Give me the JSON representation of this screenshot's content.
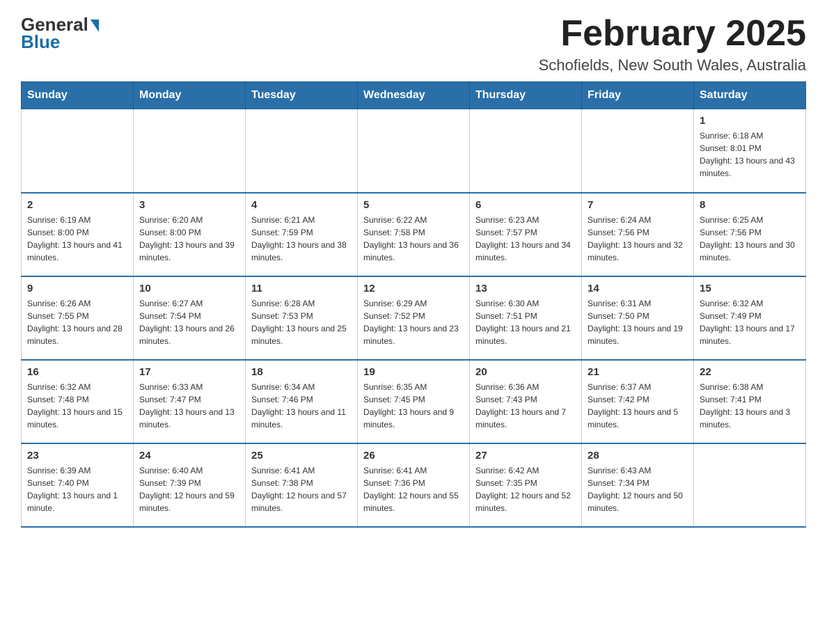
{
  "header": {
    "logo_general": "General",
    "logo_blue": "Blue",
    "title": "February 2025",
    "subtitle": "Schofields, New South Wales, Australia"
  },
  "days_of_week": [
    "Sunday",
    "Monday",
    "Tuesday",
    "Wednesday",
    "Thursday",
    "Friday",
    "Saturday"
  ],
  "weeks": [
    {
      "days": [
        {
          "number": "",
          "info": ""
        },
        {
          "number": "",
          "info": ""
        },
        {
          "number": "",
          "info": ""
        },
        {
          "number": "",
          "info": ""
        },
        {
          "number": "",
          "info": ""
        },
        {
          "number": "",
          "info": ""
        },
        {
          "number": "1",
          "info": "Sunrise: 6:18 AM\nSunset: 8:01 PM\nDaylight: 13 hours and 43 minutes."
        }
      ]
    },
    {
      "days": [
        {
          "number": "2",
          "info": "Sunrise: 6:19 AM\nSunset: 8:00 PM\nDaylight: 13 hours and 41 minutes."
        },
        {
          "number": "3",
          "info": "Sunrise: 6:20 AM\nSunset: 8:00 PM\nDaylight: 13 hours and 39 minutes."
        },
        {
          "number": "4",
          "info": "Sunrise: 6:21 AM\nSunset: 7:59 PM\nDaylight: 13 hours and 38 minutes."
        },
        {
          "number": "5",
          "info": "Sunrise: 6:22 AM\nSunset: 7:58 PM\nDaylight: 13 hours and 36 minutes."
        },
        {
          "number": "6",
          "info": "Sunrise: 6:23 AM\nSunset: 7:57 PM\nDaylight: 13 hours and 34 minutes."
        },
        {
          "number": "7",
          "info": "Sunrise: 6:24 AM\nSunset: 7:56 PM\nDaylight: 13 hours and 32 minutes."
        },
        {
          "number": "8",
          "info": "Sunrise: 6:25 AM\nSunset: 7:56 PM\nDaylight: 13 hours and 30 minutes."
        }
      ]
    },
    {
      "days": [
        {
          "number": "9",
          "info": "Sunrise: 6:26 AM\nSunset: 7:55 PM\nDaylight: 13 hours and 28 minutes."
        },
        {
          "number": "10",
          "info": "Sunrise: 6:27 AM\nSunset: 7:54 PM\nDaylight: 13 hours and 26 minutes."
        },
        {
          "number": "11",
          "info": "Sunrise: 6:28 AM\nSunset: 7:53 PM\nDaylight: 13 hours and 25 minutes."
        },
        {
          "number": "12",
          "info": "Sunrise: 6:29 AM\nSunset: 7:52 PM\nDaylight: 13 hours and 23 minutes."
        },
        {
          "number": "13",
          "info": "Sunrise: 6:30 AM\nSunset: 7:51 PM\nDaylight: 13 hours and 21 minutes."
        },
        {
          "number": "14",
          "info": "Sunrise: 6:31 AM\nSunset: 7:50 PM\nDaylight: 13 hours and 19 minutes."
        },
        {
          "number": "15",
          "info": "Sunrise: 6:32 AM\nSunset: 7:49 PM\nDaylight: 13 hours and 17 minutes."
        }
      ]
    },
    {
      "days": [
        {
          "number": "16",
          "info": "Sunrise: 6:32 AM\nSunset: 7:48 PM\nDaylight: 13 hours and 15 minutes."
        },
        {
          "number": "17",
          "info": "Sunrise: 6:33 AM\nSunset: 7:47 PM\nDaylight: 13 hours and 13 minutes."
        },
        {
          "number": "18",
          "info": "Sunrise: 6:34 AM\nSunset: 7:46 PM\nDaylight: 13 hours and 11 minutes."
        },
        {
          "number": "19",
          "info": "Sunrise: 6:35 AM\nSunset: 7:45 PM\nDaylight: 13 hours and 9 minutes."
        },
        {
          "number": "20",
          "info": "Sunrise: 6:36 AM\nSunset: 7:43 PM\nDaylight: 13 hours and 7 minutes."
        },
        {
          "number": "21",
          "info": "Sunrise: 6:37 AM\nSunset: 7:42 PM\nDaylight: 13 hours and 5 minutes."
        },
        {
          "number": "22",
          "info": "Sunrise: 6:38 AM\nSunset: 7:41 PM\nDaylight: 13 hours and 3 minutes."
        }
      ]
    },
    {
      "days": [
        {
          "number": "23",
          "info": "Sunrise: 6:39 AM\nSunset: 7:40 PM\nDaylight: 13 hours and 1 minute."
        },
        {
          "number": "24",
          "info": "Sunrise: 6:40 AM\nSunset: 7:39 PM\nDaylight: 12 hours and 59 minutes."
        },
        {
          "number": "25",
          "info": "Sunrise: 6:41 AM\nSunset: 7:38 PM\nDaylight: 12 hours and 57 minutes."
        },
        {
          "number": "26",
          "info": "Sunrise: 6:41 AM\nSunset: 7:36 PM\nDaylight: 12 hours and 55 minutes."
        },
        {
          "number": "27",
          "info": "Sunrise: 6:42 AM\nSunset: 7:35 PM\nDaylight: 12 hours and 52 minutes."
        },
        {
          "number": "28",
          "info": "Sunrise: 6:43 AM\nSunset: 7:34 PM\nDaylight: 12 hours and 50 minutes."
        },
        {
          "number": "",
          "info": ""
        }
      ]
    }
  ]
}
